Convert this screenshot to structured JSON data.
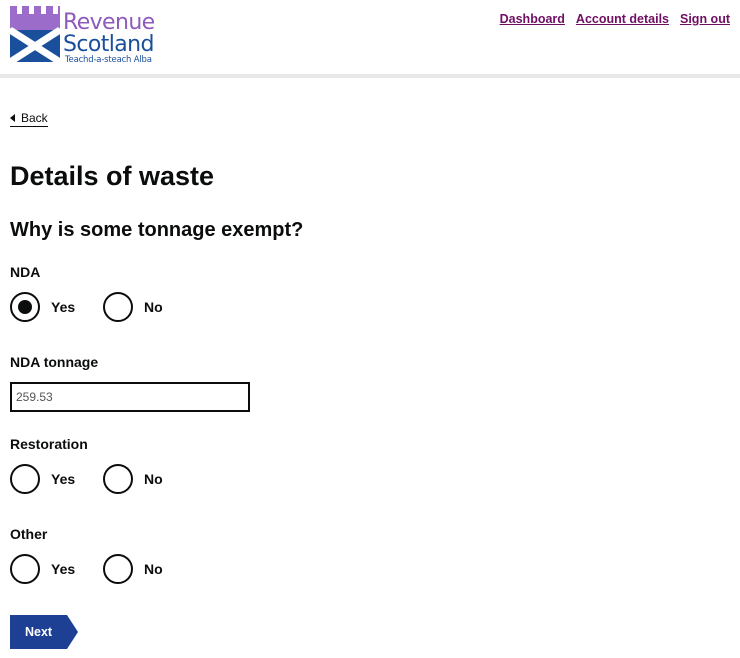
{
  "brand": {
    "name_line1": "Revenue",
    "name_line2": "Scotland",
    "tagline": "Teachd-a-steach Alba",
    "colors": {
      "purple": "#8e5bbd",
      "blue": "#1a4f9c",
      "link": "#6f0e63",
      "button": "#1d3f94"
    }
  },
  "nav": {
    "dashboard": "Dashboard",
    "account_details": "Account details",
    "sign_out": "Sign out"
  },
  "back": {
    "label": "Back",
    "icon": "triangle-left-icon"
  },
  "page": {
    "title": "Details of waste",
    "subtitle": "Why is some tonnage exempt?"
  },
  "questions": {
    "nda": {
      "label": "NDA",
      "yes": "Yes",
      "no": "No",
      "selected": "Yes"
    },
    "nda_tonnage": {
      "label": "NDA tonnage",
      "value": "259.53"
    },
    "restoration": {
      "label": "Restoration",
      "yes": "Yes",
      "no": "No",
      "selected": null
    },
    "other": {
      "label": "Other",
      "yes": "Yes",
      "no": "No",
      "selected": null
    }
  },
  "actions": {
    "next": "Next"
  }
}
